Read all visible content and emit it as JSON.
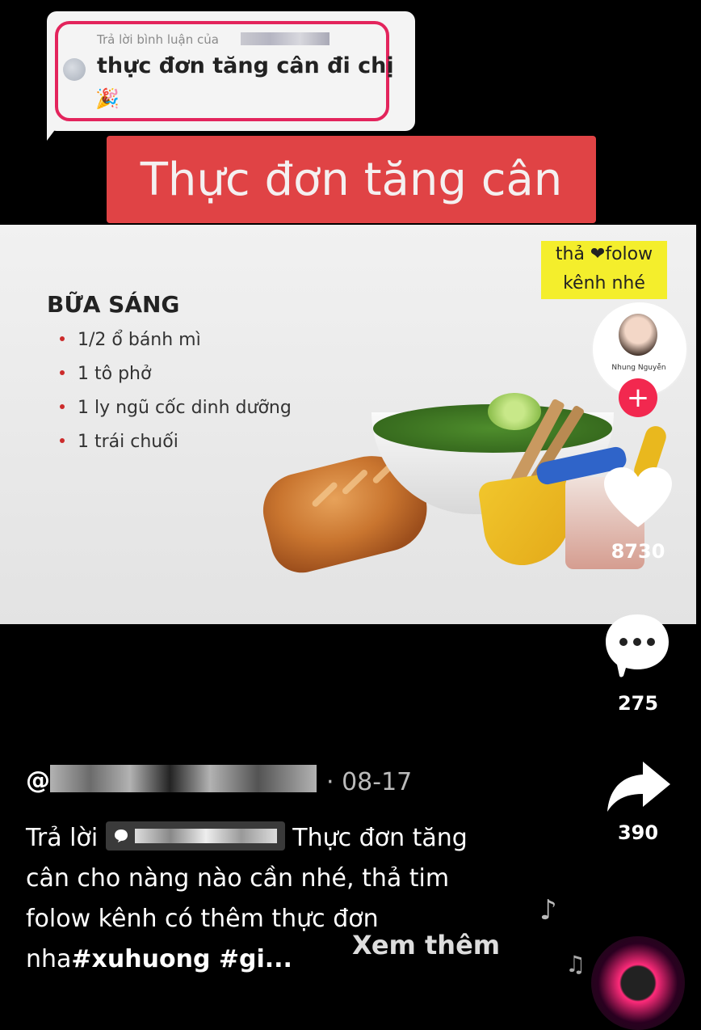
{
  "reply_bubble": {
    "header": "Trả lời bình luận của",
    "comment": "thực đơn tăng cân đi chị",
    "emoji": "🎉"
  },
  "title": "Thực đơn tăng cân",
  "slide": {
    "heading": "BỮA SÁNG",
    "items": [
      "1/2 ổ bánh mì",
      "1 tô phở",
      "1 ly ngũ cốc dinh dưỡng",
      "1 trái chuối"
    ]
  },
  "follow_sticker": {
    "line1": "thả ❤folow",
    "line2": "kênh nhé"
  },
  "profile": {
    "name": "Nhung Nguyễn",
    "follow_icon": "+"
  },
  "actions": {
    "like_count": "8730",
    "comment_count": "275",
    "share_count": "390"
  },
  "caption": {
    "handle_prefix": "@",
    "date": "· 08-17",
    "reply_prefix": "Trả lời",
    "text": "Thực đơn tăng cân cho nàng nào cần nhé, thả tim folow kênh có thêm thực đơn nha",
    "hashtags": "#xuhuong #gi...",
    "see_more": "Xem thêm"
  },
  "icons": {
    "heart": "heart-icon",
    "comment": "comment-icon",
    "share": "share-icon",
    "music": "music-note-icon"
  },
  "colors": {
    "accent_red": "#e04345",
    "follow_pink": "#f2284f",
    "sticker_yellow": "#f4ee2c"
  }
}
